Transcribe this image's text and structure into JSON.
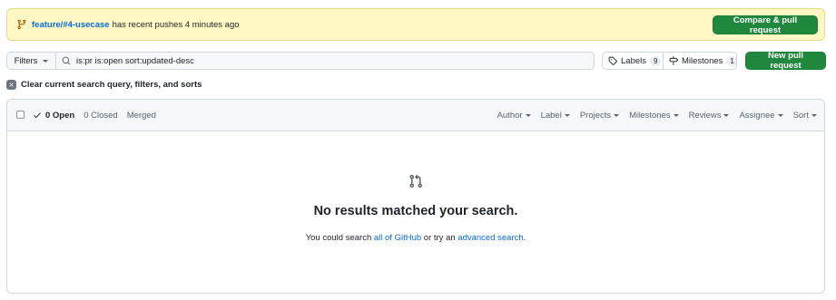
{
  "banner": {
    "branch": "feature/#4-usecase",
    "message": "has recent pushes 4 minutes ago",
    "compare_label": "Compare & pull request"
  },
  "toolbar": {
    "filters_label": "Filters",
    "search_value": "is:pr is:open sort:updated-desc",
    "labels_label": "Labels",
    "labels_count": "9",
    "milestones_label": "Milestones",
    "milestones_count": "1",
    "new_pr_label": "New pull request"
  },
  "clear": {
    "label": "Clear current search query, filters, and sorts"
  },
  "list_header": {
    "open_label": "0 Open",
    "closed_label": "0 Closed",
    "merged_label": "Merged",
    "filters": [
      "Author",
      "Label",
      "Projects",
      "Milestones",
      "Reviews",
      "Assignee",
      "Sort"
    ]
  },
  "empty_state": {
    "title": "No results matched your search.",
    "text_before": "You could search",
    "link1": "all of GitHub",
    "text_middle": "or try an",
    "link2": "advanced search",
    "text_after": "."
  },
  "colors": {
    "accent": "#0969da",
    "primary_button": "#1f883d",
    "banner_bg": "#fff8c5"
  },
  "icons": [
    "git-branch-icon",
    "search-icon",
    "tag-icon",
    "milestone-icon",
    "x-icon",
    "check-icon",
    "git-pull-request-icon"
  ]
}
